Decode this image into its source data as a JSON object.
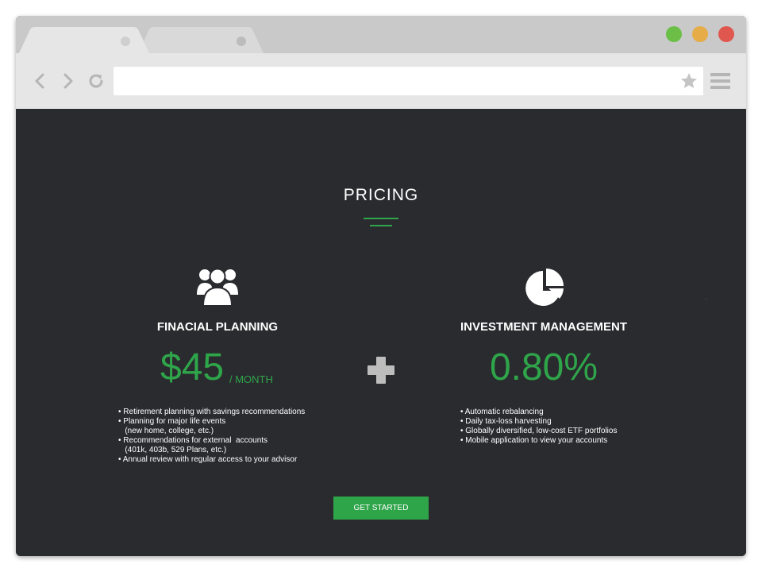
{
  "browser": {
    "traffic_lights": {
      "green": "#6bbf47",
      "yellow": "#e5ac47",
      "red": "#e0574f"
    },
    "url_value": ""
  },
  "page": {
    "title": "PRICING",
    "accent_color": "#2fa54a",
    "background_color": "#2a2b2f",
    "financial_planning": {
      "icon": "users-icon",
      "heading": "FINACIAL PLANNING",
      "price": "$45",
      "price_suffix": "/ MONTH",
      "features": [
        "• Retirement planning with savings recommendations",
        "• Planning for major life events",
        "   (new home, college, etc.)",
        "• Recommendations for external  accounts",
        "   (401k, 403b, 529 Plans, etc.)",
        "• Annual review with regular access to your advisor"
      ]
    },
    "investment_management": {
      "icon": "pie-chart-icon",
      "heading": "INVESTMENT MANAGEMENT",
      "price": "0.80%",
      "features": [
        "• Automatic rebalancing",
        "• Daily tax-loss harvesting",
        "• Globally diversified, low-cost ETF portfolios",
        "• Mobile application to view your accounts"
      ]
    },
    "cta_label": "GET STARTED"
  }
}
